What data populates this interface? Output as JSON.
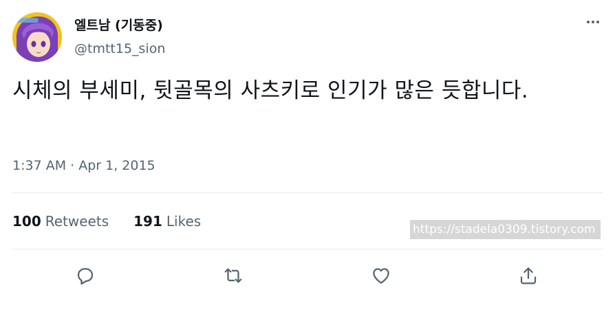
{
  "author": {
    "display_name": "엘트남 (기동중)",
    "handle": "@tmtt15_sion",
    "avatar_icon": "anime-character-avatar"
  },
  "tweet": {
    "text": "시체의 부세미, 뒷골목의 사츠키로 인기가 많은 듯합니다.",
    "timestamp": "1:37 AM · Apr 1, 2015"
  },
  "stats": {
    "retweets_count": "100",
    "retweets_label": "Retweets",
    "likes_count": "191",
    "likes_label": "Likes"
  },
  "watermark": "https://stadela0309.tistory.com",
  "actions": {
    "reply_icon": "reply-icon",
    "retweet_icon": "retweet-icon",
    "like_icon": "heart-icon",
    "share_icon": "share-icon"
  },
  "colors": {
    "text_primary": "#0f1419",
    "text_secondary": "#536471",
    "divider": "#e7e9ea",
    "avatar_background": "#f3c21c"
  }
}
